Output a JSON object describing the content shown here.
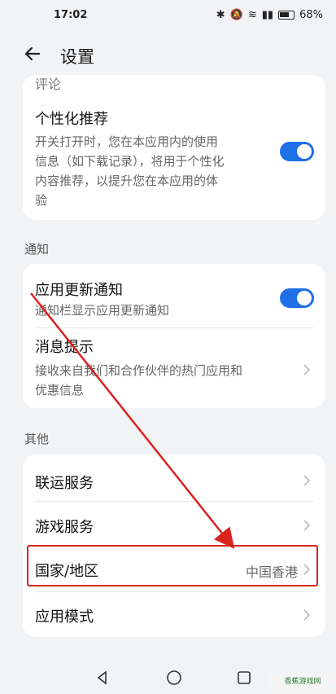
{
  "status": {
    "time": "17:02",
    "battery": "68%"
  },
  "header": {
    "title": "设置"
  },
  "top_card": {
    "cut_label": "评论",
    "personal_title": "个性化推荐",
    "personal_desc": [
      "开关打开时，您在本应用内的使用",
      "信息（如下载记录），将用于个性化",
      "内容推荐，以提升您在本应用的体",
      "验"
    ]
  },
  "sections": {
    "notify": "通知",
    "other": "其他"
  },
  "notify_card": {
    "update_title": "应用更新通知",
    "update_desc": "通知栏显示应用更新通知",
    "message_title": "消息提示",
    "message_desc": [
      "接收来自我们和合作伙伴的热门应用和",
      "优惠信息"
    ]
  },
  "other_card": {
    "items": [
      {
        "label": "联运服务",
        "value": ""
      },
      {
        "label": "游戏服务",
        "value": ""
      },
      {
        "label": "国家/地区",
        "value": "中国香港"
      },
      {
        "label": "应用模式",
        "value": ""
      }
    ]
  },
  "watermark": "香蕉游戏网",
  "colors": {
    "accent": "#1f6fe6",
    "annotation": "#d9231f",
    "background": "#f1f3f5"
  }
}
